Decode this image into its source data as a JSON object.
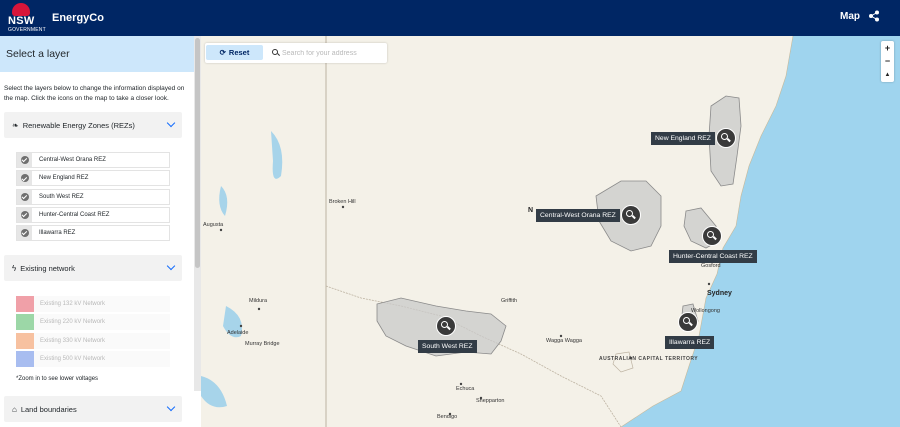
{
  "header": {
    "logo_text": "NSW",
    "logo_subtext": "GOVERNMENT",
    "app_name": "EnergyCo",
    "nav_map": "Map"
  },
  "sidebar": {
    "title": "Select a layer",
    "intro": "Select the layers below to change the information displayed on the map. Click the icons on the map to take a closer look.",
    "sections": {
      "rez": "Renewable Energy Zones (REZs)",
      "network": "Existing network",
      "land": "Land boundaries"
    },
    "rez_items": [
      "Central-West Orana REZ",
      "New England REZ",
      "South West REZ",
      "Hunter-Central Coast REZ",
      "Illawarra REZ"
    ],
    "network_items": [
      {
        "label": "Existing 132 kV Network",
        "color": "#f0a0a8"
      },
      {
        "label": "Existing 220 kV Network",
        "color": "#9cd7a7"
      },
      {
        "label": "Existing 330 kV Network",
        "color": "#f7c1a0"
      },
      {
        "label": "Existing 500 kV Network",
        "color": "#a8bdf0"
      }
    ],
    "zoom_note": "*Zoom in to see lower voltages"
  },
  "map": {
    "reset_label": "Reset",
    "search_placeholder": "Search for your address",
    "zoom_in": "+",
    "zoom_out": "−",
    "compass": "▲",
    "rez_labels": {
      "new_england": "New England REZ",
      "central_west": "Central-West Orana REZ",
      "hunter": "Hunter-Central Coast REZ",
      "south_west": "South West REZ",
      "illawarra": "Illawarra REZ"
    },
    "places": {
      "broken_hill": "Broken Hill",
      "augusta": "Augusta",
      "mildura": "Mildura",
      "adelaide": "Adelaide",
      "murray_bridge": "Murray Bridge",
      "sydney": "Sydney",
      "gosford": "Gosford",
      "wollongong": "Wollongong",
      "wagga": "Wagga Wagga",
      "act": "AUSTRALIAN CAPITAL TERRITORY",
      "echuca": "Echuca",
      "shepparton": "Shepparton",
      "bendigo": "Bendigo",
      "griffith": "Griffith",
      "n": "N"
    },
    "colors": {
      "land": "#f4f1e8",
      "sea": "#9fd4ee",
      "rez_fill": "#c9c9c9",
      "header": "#002664"
    }
  }
}
